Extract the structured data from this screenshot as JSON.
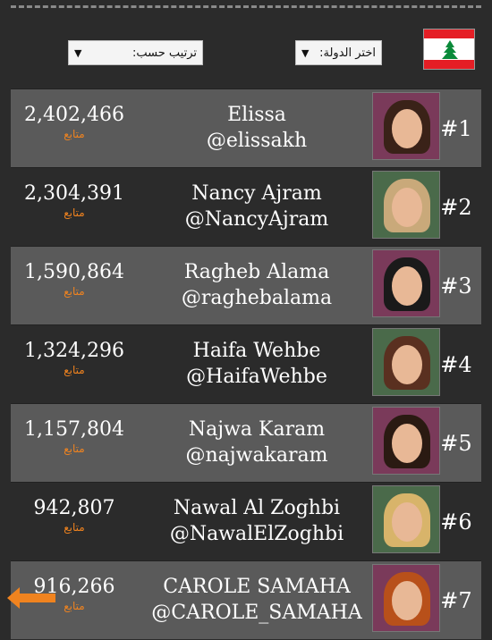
{
  "header": {
    "country_label": "اختر الدولة:",
    "sort_label": "ترتيب حسب:",
    "dropdown_arrow": "▼",
    "flag_icon": "lebanon-flag-icon"
  },
  "rows": [
    {
      "rank": "#1",
      "name": "Elissa",
      "handle": "@elissakh",
      "count": "2,402,466",
      "follow_label": "متابع",
      "hair": "#3a2218"
    },
    {
      "rank": "#2",
      "name": "Nancy Ajram",
      "handle": "@NancyAjram",
      "count": "2,304,391",
      "follow_label": "متابع",
      "hair": "#c9a97a"
    },
    {
      "rank": "#3",
      "name": "Ragheb Alama",
      "handle": "@raghebalama",
      "count": "1,590,864",
      "follow_label": "متابع",
      "hair": "#1a1a1a"
    },
    {
      "rank": "#4",
      "name": "Haifa Wehbe",
      "handle": "@HaifaWehbe",
      "count": "1,324,296",
      "follow_label": "متابع",
      "hair": "#5a3020"
    },
    {
      "rank": "#5",
      "name": "Najwa Karam",
      "handle": "@najwakaram",
      "count": "1,157,804",
      "follow_label": "متابع",
      "hair": "#2a1a12"
    },
    {
      "rank": "#6",
      "name": "Nawal Al Zoghbi",
      "handle": "@NawalElZoghbi",
      "count": "942,807",
      "follow_label": "متابع",
      "hair": "#d8b46a"
    },
    {
      "rank": "#7",
      "name": "CAROLE SAMAHA",
      "handle": "@CAROLE_SAMAHA",
      "count": "916,266",
      "follow_label": "متابع",
      "hair": "#b8501a"
    }
  ],
  "colors": {
    "accent_orange": "#f0831f",
    "row_alt": "#5a5a5a",
    "background": "#2b2b2b"
  },
  "back_button_icon": "left-arrow-icon"
}
